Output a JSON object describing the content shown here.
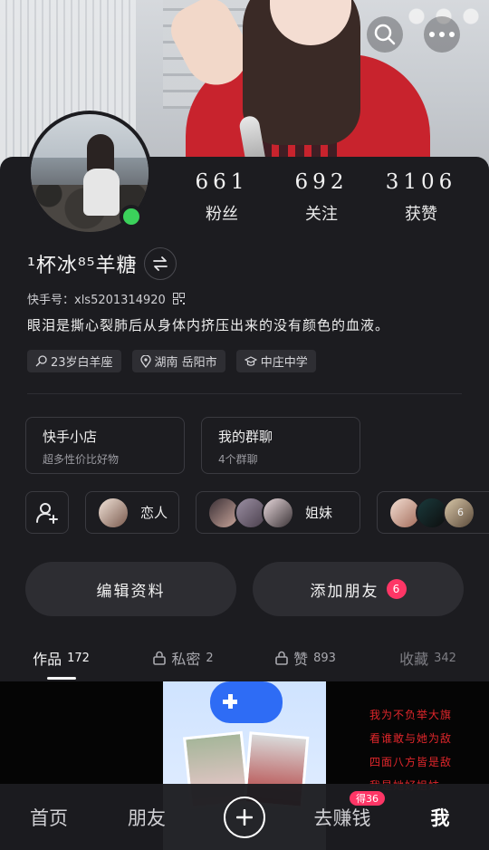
{
  "header": {
    "search_icon": "search-icon",
    "more_icon": "more-icon"
  },
  "profile": {
    "name": "¹杯冰⁸⁵羊糖",
    "kuaishou_id": "快手号：xls5201314920",
    "bio": "眼泪是撕心裂肺后从身体内挤压出来的没有颜色的血液。",
    "online_color": "#3bd15b"
  },
  "stats": [
    {
      "value": "661",
      "label": "粉丝"
    },
    {
      "value": "692",
      "label": "关注"
    },
    {
      "value": "3106",
      "label": "获赞"
    }
  ],
  "tags": [
    {
      "icon": "age-icon",
      "text": "23岁白羊座"
    },
    {
      "icon": "location-icon",
      "text": "湖南 岳阳市"
    },
    {
      "icon": "school-icon",
      "text": "中庄中学"
    }
  ],
  "cards": [
    {
      "title": "快手小店",
      "subtitle": "超多性价比好物"
    },
    {
      "title": "我的群聊",
      "subtitle": "4个群聊"
    }
  ],
  "groups": [
    {
      "label": "恋人"
    },
    {
      "label": "姐妹"
    },
    {
      "label": "6"
    }
  ],
  "actions": {
    "edit": "编辑资料",
    "add_friend": "添加朋友",
    "add_friend_badge": "6"
  },
  "tabs": [
    {
      "label": "作品",
      "count": "172"
    },
    {
      "label": "私密",
      "count": "2"
    },
    {
      "label": "赞",
      "count": "893"
    },
    {
      "label": "收藏",
      "count": "342"
    }
  ],
  "works": {
    "poem_lines": [
      "我为不负举大旗",
      "看谁敢与她为敌",
      "四面八方皆是敌",
      "我是她好姐妹"
    ]
  },
  "bottom_nav": {
    "home": "首页",
    "friends": "朋友",
    "earn": "去赚钱",
    "earn_badge": "得36",
    "me": "我"
  },
  "colors": {
    "accent": "#fe3666",
    "background": "#1c1c20"
  }
}
